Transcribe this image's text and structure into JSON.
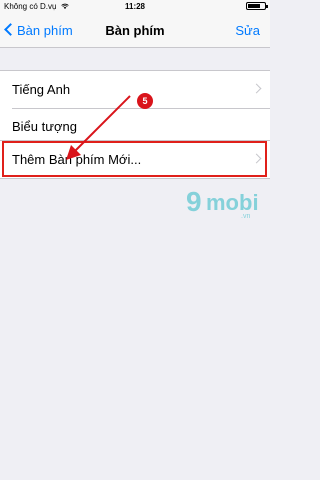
{
  "status_bar": {
    "carrier": "Không có D.vụ",
    "time": "11:28"
  },
  "nav": {
    "back_label": "Bàn phím",
    "title": "Bàn phím",
    "edit_label": "Sửa"
  },
  "keyboards": [
    {
      "label": "Tiếng Anh",
      "has_chevron": true
    },
    {
      "label": "Biểu tượng",
      "has_chevron": false
    }
  ],
  "add_keyboard": {
    "label": "Thêm Bàn phím Mới..."
  },
  "annotation": {
    "step_number": "5",
    "highlight_color": "#e0201a"
  },
  "watermark": {
    "logo": "9",
    "name": "mobi",
    "domain": ".vn"
  },
  "colors": {
    "accent": "#007aff",
    "background": "#efeff4"
  }
}
